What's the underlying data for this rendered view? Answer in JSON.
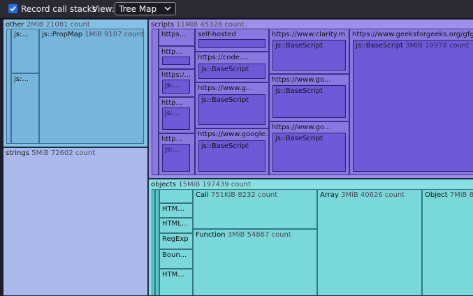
{
  "toolbar": {
    "record_label": "Record call stacks",
    "record_checked": true,
    "view_label": "View:",
    "view_value": "Tree Map"
  },
  "treemap": {
    "other": {
      "label": "other",
      "meta": "2MiB 21081 count",
      "children": [
        "js:...",
        "js:...",
        "js::PropMap"
      ],
      "propmap_meta": "1MiB 9107 count"
    },
    "strings": {
      "label": "strings",
      "meta": "5MiB 72602 count"
    },
    "scripts": {
      "label": "scripts",
      "meta": "11MiB 45326 count",
      "col1": [
        "https...",
        "http...",
        "https:/...",
        "js:...",
        "http...",
        "js:...",
        "http...",
        "js:..."
      ],
      "self_hosted": "self-hosted",
      "code": "https://code....",
      "www_g": "https://www.g...",
      "google": "https://www.google...",
      "clarity": "https://www.clarity.m...",
      "go1": "https://www.go...",
      "go2": "https://www.go...",
      "gfg": "https://www.geeksforgeeks.org/gfg-...",
      "base": "js::BaseScript",
      "gfg_meta": "3MiB 10978 count"
    },
    "objects": {
      "label": "objects",
      "meta": "15MiB 197439 count",
      "left_items": [
        "HTM...",
        "HTML...",
        "RegExp",
        "Boun...",
        "HTM..."
      ],
      "call": "Call",
      "call_meta": "751KiB 8232 count",
      "function": "Function",
      "function_meta": "3MiB 54867 count",
      "array": "Array",
      "array_meta": "3MiB 40626 count",
      "object": "Object",
      "object_meta": "7MiB 8..."
    }
  }
}
